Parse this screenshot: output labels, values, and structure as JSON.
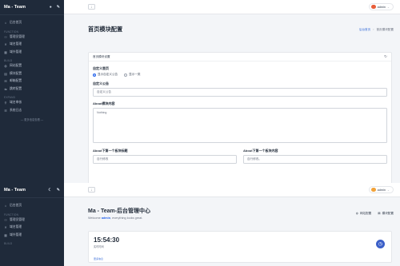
{
  "brand": {
    "name": "Ma - Team"
  },
  "nav": {
    "home": "后台首页",
    "function_label": "FUNCTION",
    "function_items": [
      "管理员管理",
      "域名管理",
      "域外管理"
    ],
    "build_label": "BUILD",
    "build_items": [
      "网站配置",
      "模块配置",
      "邮箱配置",
      "跳转配置"
    ],
    "expand_label": "EXPAND",
    "expand_items": [
      "域名审核",
      "系统日志"
    ],
    "collapse": "— 更多信息查看 —"
  },
  "nav_bottom": {
    "home": "后台首页",
    "function_label": "FUNCTION",
    "function_items": [
      "管理员管理",
      "域名管理",
      "域外管理"
    ],
    "build_label": "BUILD"
  },
  "topbar": {
    "user": "admin"
  },
  "top_page": {
    "title": "首页模块配置",
    "breadcrumb": [
      "后台首页",
      "首页模块配置"
    ],
    "card_title": "首页模块设置",
    "custom_home_label": "自定义首页",
    "radio_options": [
      "显示自定义公告",
      "显示一类"
    ],
    "custom_notice_label": "自定义公告",
    "custom_notice_value": "自定义公告",
    "about_label": "About模块内容",
    "about_value": "Nothing",
    "about_title1_label": "About下第一个板块标题",
    "about_title1_value": "自行修改",
    "about_content1_label": "About下第一个板块内容",
    "about_content1_value": "自行修改。"
  },
  "bottom_page": {
    "title": "Ma - Team-后台管理中心",
    "welcome_prefix": "Welcome",
    "welcome_user": "admin",
    "welcome_suffix": ", everything looks great.",
    "action_site": "网站配置",
    "action_module": "模块配置",
    "clock_time": "15:54:30",
    "clock_label": "实时时间",
    "clock_footer": "更多信息"
  }
}
